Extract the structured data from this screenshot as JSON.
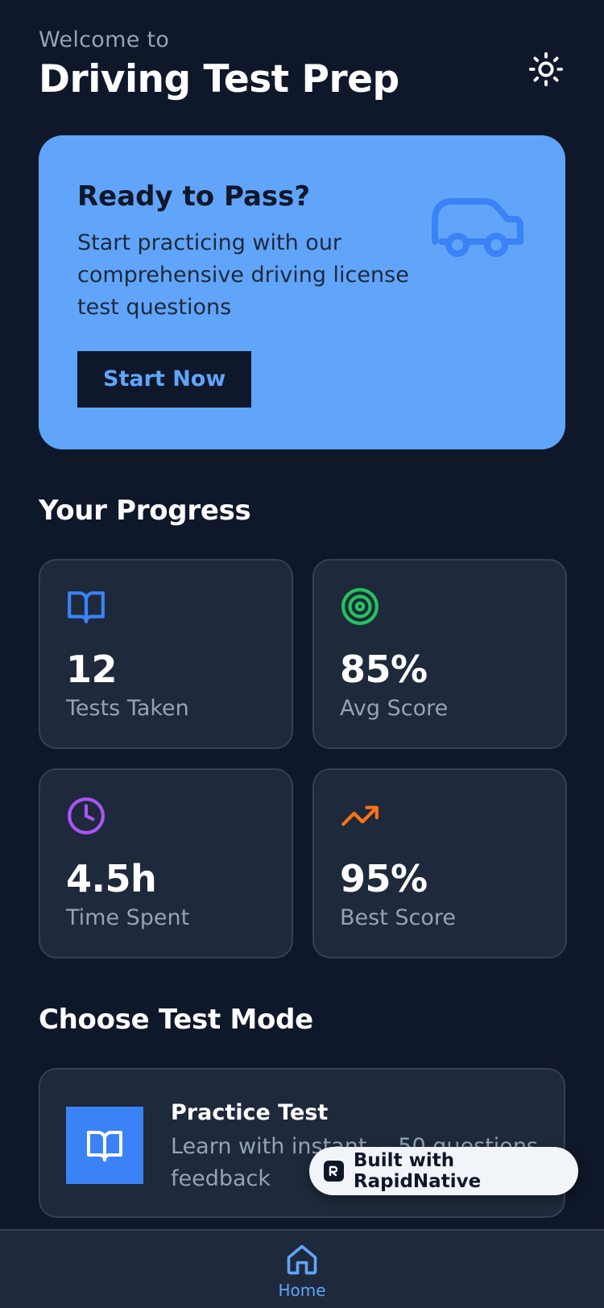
{
  "header": {
    "welcome": "Welcome to",
    "title": "Driving Test Prep",
    "theme_icon": "sun-icon"
  },
  "hero": {
    "title": "Ready to Pass?",
    "description": "Start practicing with our comprehensive driving license test questions",
    "button_label": "Start Now",
    "icon": "car-icon"
  },
  "progress": {
    "section_title": "Your Progress",
    "stats": [
      {
        "value": "12",
        "label": "Tests Taken",
        "icon": "book-open-icon",
        "color": "#3b82f6"
      },
      {
        "value": "85%",
        "label": "Avg Score",
        "icon": "target-icon",
        "color": "#22c55e"
      },
      {
        "value": "4.5h",
        "label": "Time Spent",
        "icon": "clock-icon",
        "color": "#a855f7"
      },
      {
        "value": "95%",
        "label": "Best Score",
        "icon": "trending-up-icon",
        "color": "#f97316"
      }
    ]
  },
  "modes": {
    "section_title": "Choose Test Mode",
    "items": [
      {
        "title": "Practice Test",
        "description": "Learn with instant feedback",
        "meta": "50 questions",
        "icon": "book-open-icon"
      }
    ]
  },
  "badge": {
    "label": "Built with RapidNative"
  },
  "nav": {
    "home_label": "Home"
  },
  "colors": {
    "background": "#0f172a",
    "card": "#1e293b",
    "accent": "#60a5fa",
    "primary": "#3b82f6"
  }
}
